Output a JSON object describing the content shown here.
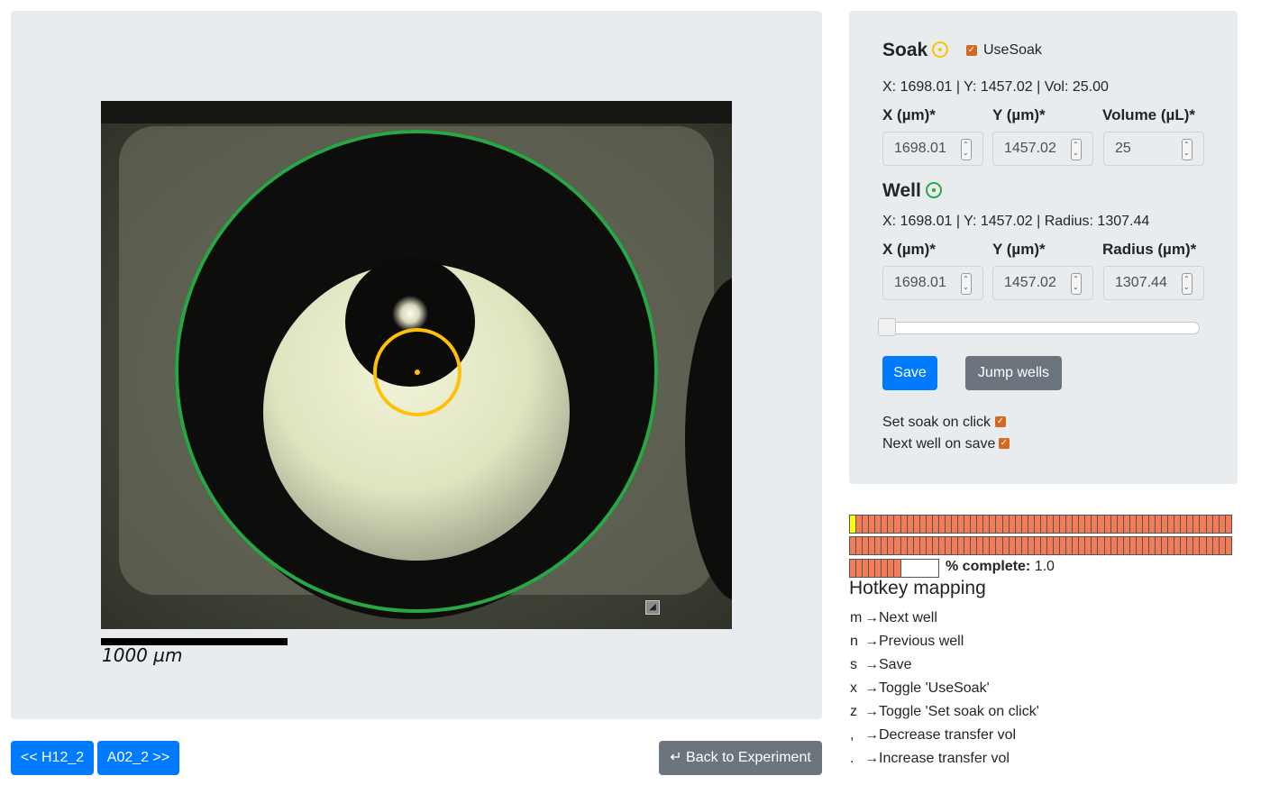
{
  "image": {
    "scalebar_label": "1000 µm"
  },
  "nav": {
    "prev_label": "<< H12_2",
    "next_label": "A02_2 >>",
    "back_label": "↵ Back to Experiment"
  },
  "soak": {
    "title": "Soak",
    "usesoak_label": "UseSoak",
    "usesoak_checked": true,
    "summary": "X: 1698.01 | Y: 1457.02 | Vol: 25.00",
    "x_label": "X (µm)*",
    "y_label": "Y (µm)*",
    "vol_label": "Volume (µL)*",
    "x_value": "1698.01",
    "y_value": "1457.02",
    "vol_value": "25",
    "color": "#ffc107"
  },
  "well": {
    "title": "Well",
    "summary": "X: 1698.01 | Y: 1457.02 | Radius: 1307.44",
    "x_label": "X (µm)*",
    "y_label": "Y (µm)*",
    "radius_label": "Radius (µm)*",
    "x_value": "1698.01",
    "y_value": "1457.02",
    "radius_value": "1307.44",
    "color": "#28a745"
  },
  "slider": {
    "value_fraction": 0.0
  },
  "actions": {
    "save_label": "Save",
    "jump_label": "Jump wells",
    "set_soak_label": "Set soak on click",
    "set_soak_checked": true,
    "next_well_label": "Next well on save",
    "next_well_checked": true
  },
  "progress": {
    "total_wells": 128,
    "current_index": 0,
    "complete_label": "% complete:",
    "complete_value": "1.0",
    "colors": {
      "done": "#f47b57",
      "current": "#ffff00"
    }
  },
  "hotkeys": {
    "title": "Hotkey mapping",
    "items": [
      {
        "key": "m",
        "action": "→Next well"
      },
      {
        "key": "n",
        "action": "→Previous well"
      },
      {
        "key": "s",
        "action": "→Save"
      },
      {
        "key": "x",
        "action": "→Toggle 'UseSoak'"
      },
      {
        "key": "z",
        "action": "→Toggle 'Set soak on click'"
      },
      {
        "key": ",",
        "action": "→Decrease transfer vol"
      },
      {
        "key": ".",
        "action": "→Increase transfer vol"
      }
    ]
  }
}
